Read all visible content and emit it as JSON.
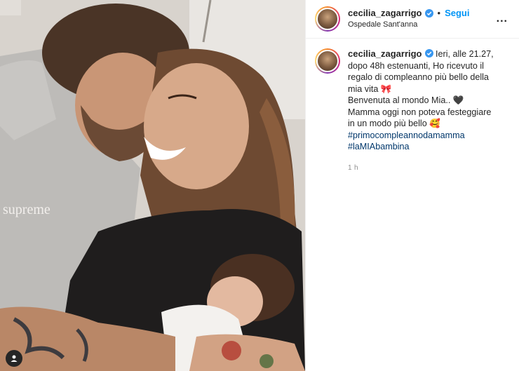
{
  "post": {
    "username": "cecilia_zagarrigo",
    "follow_label": "Segui",
    "separator": "•",
    "location": "Ospedale Sant'anna",
    "more_label": "...",
    "caption_lines": [
      "Ieri, alle 21.27,",
      "dopo 48h estenuanti, Ho ricevuto il",
      "regalo di compleanno più bello della",
      "mia vita 🎀",
      "Benvenuta al mondo Mia.. 🖤",
      "Mamma oggi non poteva festeggiare",
      "in un modo più bello 🥰"
    ],
    "hashtags": [
      "#primocompleannodamamma",
      "#laMIAbambina"
    ],
    "time": "1 h"
  },
  "photo": {
    "shirt_text": "supreme"
  },
  "colors": {
    "follow": "#0095f6",
    "hashtag": "#00376b",
    "verified": "#3897f0"
  }
}
